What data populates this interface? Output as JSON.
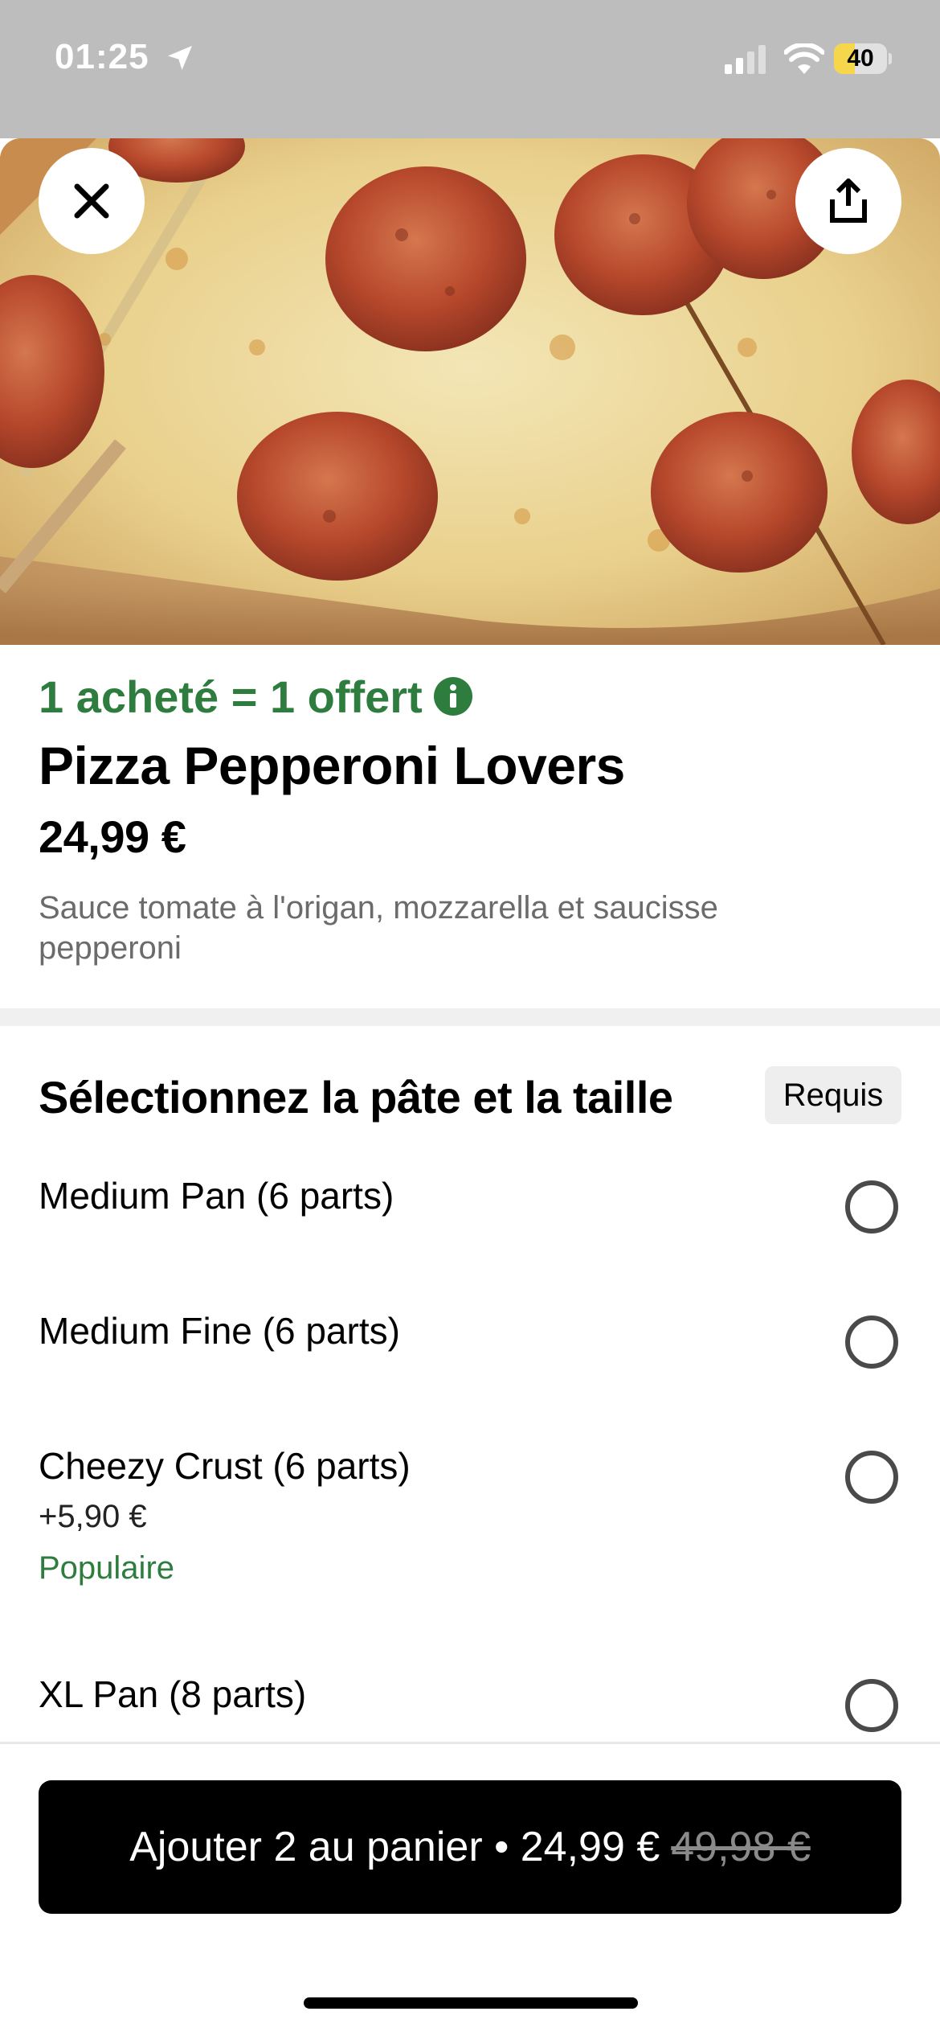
{
  "status_bar": {
    "time": "01:25",
    "battery": "40",
    "battery_level": 0.4,
    "icons": [
      "location-arrow-icon",
      "signal-icon",
      "wifi-icon",
      "battery-icon"
    ]
  },
  "header": {
    "close_icon": "close-icon",
    "share_icon": "share-icon"
  },
  "product": {
    "promo": "1 acheté = 1 offert",
    "promo_icon": "info-icon",
    "name": "Pizza Pepperoni Lovers",
    "price": "24,99 €",
    "description": "Sauce tomate à l'origan, mozzarella et saucisse pepperoni"
  },
  "options_section": {
    "title": "Sélectionnez la pâte et la taille",
    "required_label": "Requis",
    "options": [
      {
        "label": "Medium Pan (6 parts)",
        "extra": "",
        "tag": ""
      },
      {
        "label": "Medium Fine (6 parts)",
        "extra": "",
        "tag": ""
      },
      {
        "label": "Cheezy Crust (6 parts)",
        "extra": "+5,90 €",
        "tag": "Populaire"
      },
      {
        "label": "XL Pan (8 parts)",
        "extra": "",
        "tag": ""
      }
    ]
  },
  "footer": {
    "cta_label": "Ajouter 2 au panier • 24,99 €",
    "cta_old_price": "49,98 €"
  },
  "colors": {
    "promo_green": "#2e7d3e",
    "cta_background": "#000000",
    "status_bar_gray": "#bdbdbd",
    "battery_yellow": "#f6d64a"
  }
}
